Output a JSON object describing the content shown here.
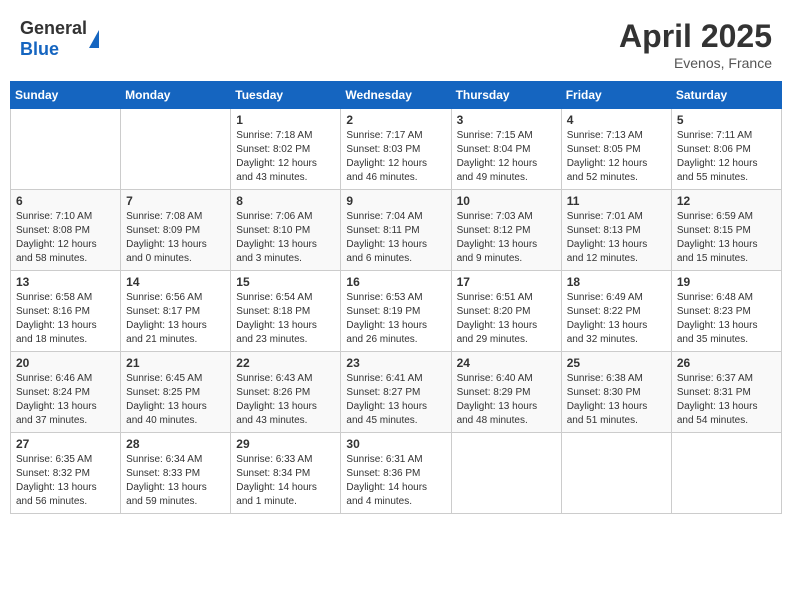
{
  "header": {
    "logo_general": "General",
    "logo_blue": "Blue",
    "month_title": "April 2025",
    "location": "Evenos, France"
  },
  "days_of_week": [
    "Sunday",
    "Monday",
    "Tuesday",
    "Wednesday",
    "Thursday",
    "Friday",
    "Saturday"
  ],
  "weeks": [
    [
      {
        "day": "",
        "text": ""
      },
      {
        "day": "",
        "text": ""
      },
      {
        "day": "1",
        "text": "Sunrise: 7:18 AM\nSunset: 8:02 PM\nDaylight: 12 hours and 43 minutes."
      },
      {
        "day": "2",
        "text": "Sunrise: 7:17 AM\nSunset: 8:03 PM\nDaylight: 12 hours and 46 minutes."
      },
      {
        "day": "3",
        "text": "Sunrise: 7:15 AM\nSunset: 8:04 PM\nDaylight: 12 hours and 49 minutes."
      },
      {
        "day": "4",
        "text": "Sunrise: 7:13 AM\nSunset: 8:05 PM\nDaylight: 12 hours and 52 minutes."
      },
      {
        "day": "5",
        "text": "Sunrise: 7:11 AM\nSunset: 8:06 PM\nDaylight: 12 hours and 55 minutes."
      }
    ],
    [
      {
        "day": "6",
        "text": "Sunrise: 7:10 AM\nSunset: 8:08 PM\nDaylight: 12 hours and 58 minutes."
      },
      {
        "day": "7",
        "text": "Sunrise: 7:08 AM\nSunset: 8:09 PM\nDaylight: 13 hours and 0 minutes."
      },
      {
        "day": "8",
        "text": "Sunrise: 7:06 AM\nSunset: 8:10 PM\nDaylight: 13 hours and 3 minutes."
      },
      {
        "day": "9",
        "text": "Sunrise: 7:04 AM\nSunset: 8:11 PM\nDaylight: 13 hours and 6 minutes."
      },
      {
        "day": "10",
        "text": "Sunrise: 7:03 AM\nSunset: 8:12 PM\nDaylight: 13 hours and 9 minutes."
      },
      {
        "day": "11",
        "text": "Sunrise: 7:01 AM\nSunset: 8:13 PM\nDaylight: 13 hours and 12 minutes."
      },
      {
        "day": "12",
        "text": "Sunrise: 6:59 AM\nSunset: 8:15 PM\nDaylight: 13 hours and 15 minutes."
      }
    ],
    [
      {
        "day": "13",
        "text": "Sunrise: 6:58 AM\nSunset: 8:16 PM\nDaylight: 13 hours and 18 minutes."
      },
      {
        "day": "14",
        "text": "Sunrise: 6:56 AM\nSunset: 8:17 PM\nDaylight: 13 hours and 21 minutes."
      },
      {
        "day": "15",
        "text": "Sunrise: 6:54 AM\nSunset: 8:18 PM\nDaylight: 13 hours and 23 minutes."
      },
      {
        "day": "16",
        "text": "Sunrise: 6:53 AM\nSunset: 8:19 PM\nDaylight: 13 hours and 26 minutes."
      },
      {
        "day": "17",
        "text": "Sunrise: 6:51 AM\nSunset: 8:20 PM\nDaylight: 13 hours and 29 minutes."
      },
      {
        "day": "18",
        "text": "Sunrise: 6:49 AM\nSunset: 8:22 PM\nDaylight: 13 hours and 32 minutes."
      },
      {
        "day": "19",
        "text": "Sunrise: 6:48 AM\nSunset: 8:23 PM\nDaylight: 13 hours and 35 minutes."
      }
    ],
    [
      {
        "day": "20",
        "text": "Sunrise: 6:46 AM\nSunset: 8:24 PM\nDaylight: 13 hours and 37 minutes."
      },
      {
        "day": "21",
        "text": "Sunrise: 6:45 AM\nSunset: 8:25 PM\nDaylight: 13 hours and 40 minutes."
      },
      {
        "day": "22",
        "text": "Sunrise: 6:43 AM\nSunset: 8:26 PM\nDaylight: 13 hours and 43 minutes."
      },
      {
        "day": "23",
        "text": "Sunrise: 6:41 AM\nSunset: 8:27 PM\nDaylight: 13 hours and 45 minutes."
      },
      {
        "day": "24",
        "text": "Sunrise: 6:40 AM\nSunset: 8:29 PM\nDaylight: 13 hours and 48 minutes."
      },
      {
        "day": "25",
        "text": "Sunrise: 6:38 AM\nSunset: 8:30 PM\nDaylight: 13 hours and 51 minutes."
      },
      {
        "day": "26",
        "text": "Sunrise: 6:37 AM\nSunset: 8:31 PM\nDaylight: 13 hours and 54 minutes."
      }
    ],
    [
      {
        "day": "27",
        "text": "Sunrise: 6:35 AM\nSunset: 8:32 PM\nDaylight: 13 hours and 56 minutes."
      },
      {
        "day": "28",
        "text": "Sunrise: 6:34 AM\nSunset: 8:33 PM\nDaylight: 13 hours and 59 minutes."
      },
      {
        "day": "29",
        "text": "Sunrise: 6:33 AM\nSunset: 8:34 PM\nDaylight: 14 hours and 1 minute."
      },
      {
        "day": "30",
        "text": "Sunrise: 6:31 AM\nSunset: 8:36 PM\nDaylight: 14 hours and 4 minutes."
      },
      {
        "day": "",
        "text": ""
      },
      {
        "day": "",
        "text": ""
      },
      {
        "day": "",
        "text": ""
      }
    ]
  ]
}
